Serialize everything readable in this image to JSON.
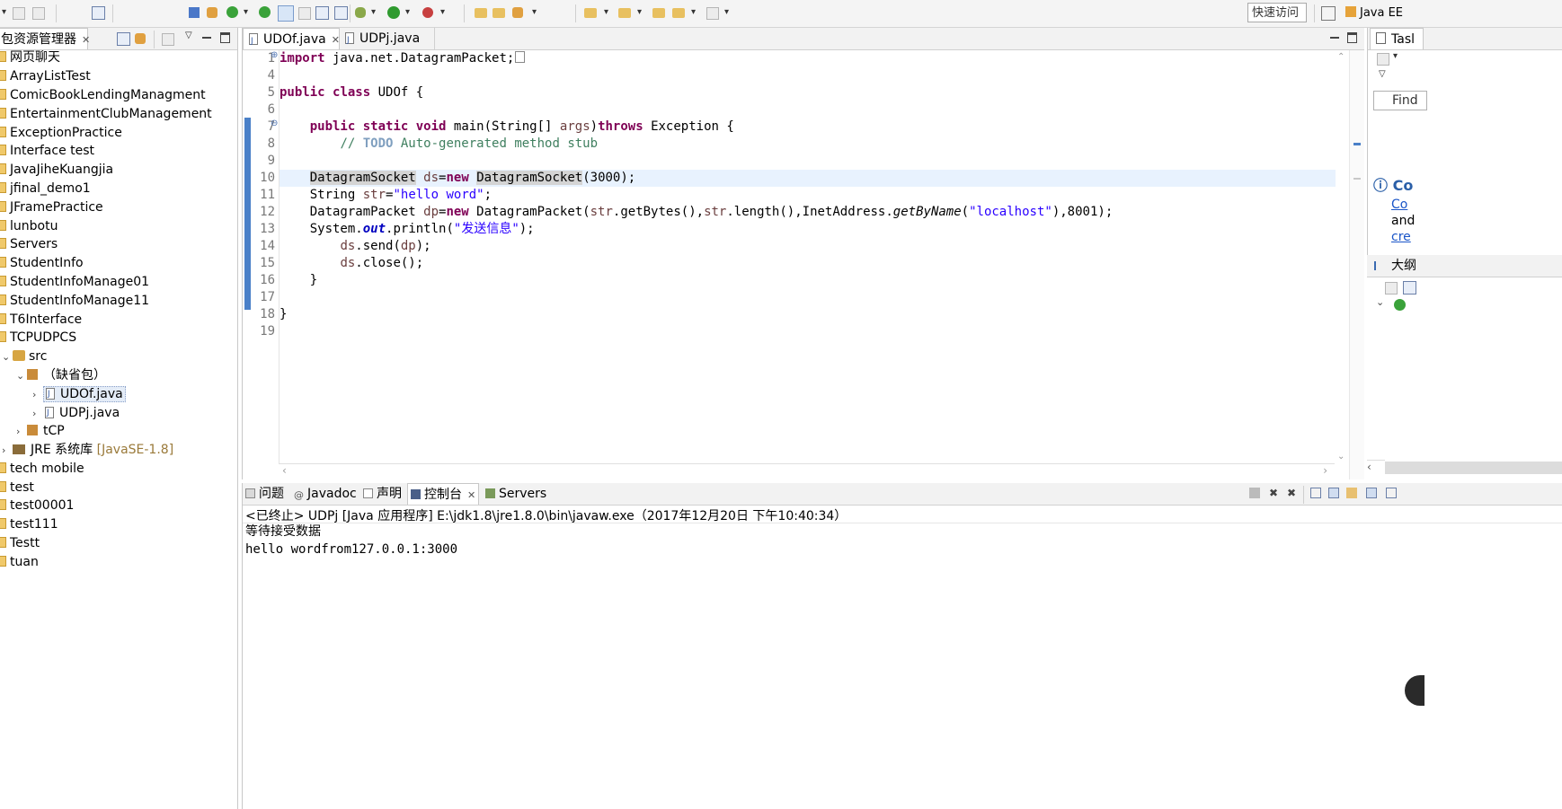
{
  "toolbar": {
    "quick_access_placeholder": "快速访问",
    "perspective_label": "Java EE"
  },
  "package_explorer": {
    "title": "包资源管理器",
    "items": [
      {
        "label": "网页聊天"
      },
      {
        "label": "ArrayListTest"
      },
      {
        "label": "ComicBookLendingManagment"
      },
      {
        "label": "EntertainmentClubManagement"
      },
      {
        "label": "ExceptionPractice"
      },
      {
        "label": "Interface test"
      },
      {
        "label": "JavaJiheKuangjia"
      },
      {
        "label": "jfinal_demo1"
      },
      {
        "label": "JFramePractice"
      },
      {
        "label": "lunbotu"
      },
      {
        "label": "Servers"
      },
      {
        "label": "StudentInfo"
      },
      {
        "label": "StudentInfoManage01"
      },
      {
        "label": "StudentInfoManage11"
      },
      {
        "label": "T6Interface"
      },
      {
        "label": "TCPUDPCS"
      }
    ],
    "src_label": "src",
    "default_pkg_label": "（缺省包）",
    "file_udpf": "UDOf.java",
    "file_udpj": "UDPj.java",
    "tcp_label": "tCP",
    "jre_label": "JRE 系统库",
    "jre_version": "[JavaSE-1.8]",
    "items_after": [
      {
        "label": "tech mobile"
      },
      {
        "label": "test"
      },
      {
        "label": "test00001"
      },
      {
        "label": "test111"
      },
      {
        "label": "Testt"
      },
      {
        "label": "tuan"
      }
    ]
  },
  "editor": {
    "tabs": [
      {
        "label": "UDOf.java"
      },
      {
        "label": "UDPj.java"
      }
    ],
    "line_numbers": [
      "1",
      "4",
      "5",
      "6",
      "7",
      "8",
      "9",
      "10",
      "11",
      "12",
      "13",
      "14",
      "15",
      "16",
      "17",
      "18",
      "19"
    ],
    "code": {
      "l1_kw": "import",
      "l1_rest": " java.net.DatagramPacket;",
      "l5_kw1": "public",
      "l5_kw2": "class",
      "l5_rest": " UDOf {",
      "l7_kw1": "public",
      "l7_kw2": "static",
      "l7_kw3": "void",
      "l7_mid": " main(String[] ",
      "l7_args": "args",
      "l7_close": ")",
      "l7_throws": "throws",
      "l7_end": " Exception {",
      "l8_cm1": "// ",
      "l8_todo": "TODO",
      "l8_cm2": " Auto-generated method stub",
      "l10_type": "DatagramSocket",
      "l10_var": "ds",
      "l10_eq": "=",
      "l10_new": "new",
      "l10_ctor": "DatagramSocket",
      "l10_end": "(3000);",
      "l11_a": "String ",
      "l11_var": "str",
      "l11_eq": "=",
      "l11_str": "\"hello word\"",
      "l11_end": ";",
      "l12_a": "DatagramPacket ",
      "l12_var": "dp",
      "l12_eq": "=",
      "l12_new": "new",
      "l12_b": " DatagramPacket(",
      "l12_v1": "str",
      "l12_c": ".getBytes(),",
      "l12_v2": "str",
      "l12_d": ".length(),InetAddress.",
      "l12_m": "getByName",
      "l12_e": "(",
      "l12_str": "\"localhost\"",
      "l12_f": "),8001);",
      "l13_a": "System.",
      "l13_out": "out",
      "l13_b": ".println(",
      "l13_str": "\"发送信息\"",
      "l13_c": ");",
      "l14_var": "ds",
      "l14_a": ".send(",
      "l14_v2": "dp",
      "l14_b": ");",
      "l15_var": "ds",
      "l15_a": ".close();",
      "l16": "}",
      "l18": "}"
    }
  },
  "right_panel": {
    "task_label": "Tasl",
    "find_placeholder": "Find",
    "connect_title": "Co",
    "connect_link1": "Co",
    "connect_text": "and",
    "connect_link2": "cre",
    "outline_title": "大纲"
  },
  "console": {
    "tabs": [
      {
        "label": "问题"
      },
      {
        "label": "Javadoc"
      },
      {
        "label": "声明"
      },
      {
        "label": "控制台"
      },
      {
        "label": "Servers"
      }
    ],
    "status": "<已终止> UDPj [Java 应用程序] E:\\jdk1.8\\jre1.8.0\\bin\\javaw.exe（2017年12月20日 下午10:40:34）",
    "lines": [
      "等待接受数据",
      "hello wordfrom127.0.0.1:3000"
    ]
  },
  "colors": {
    "keyword": "#7f0055",
    "string": "#2a00ff",
    "comment": "#3f7f5f",
    "current_line": "#e8f2fe"
  }
}
